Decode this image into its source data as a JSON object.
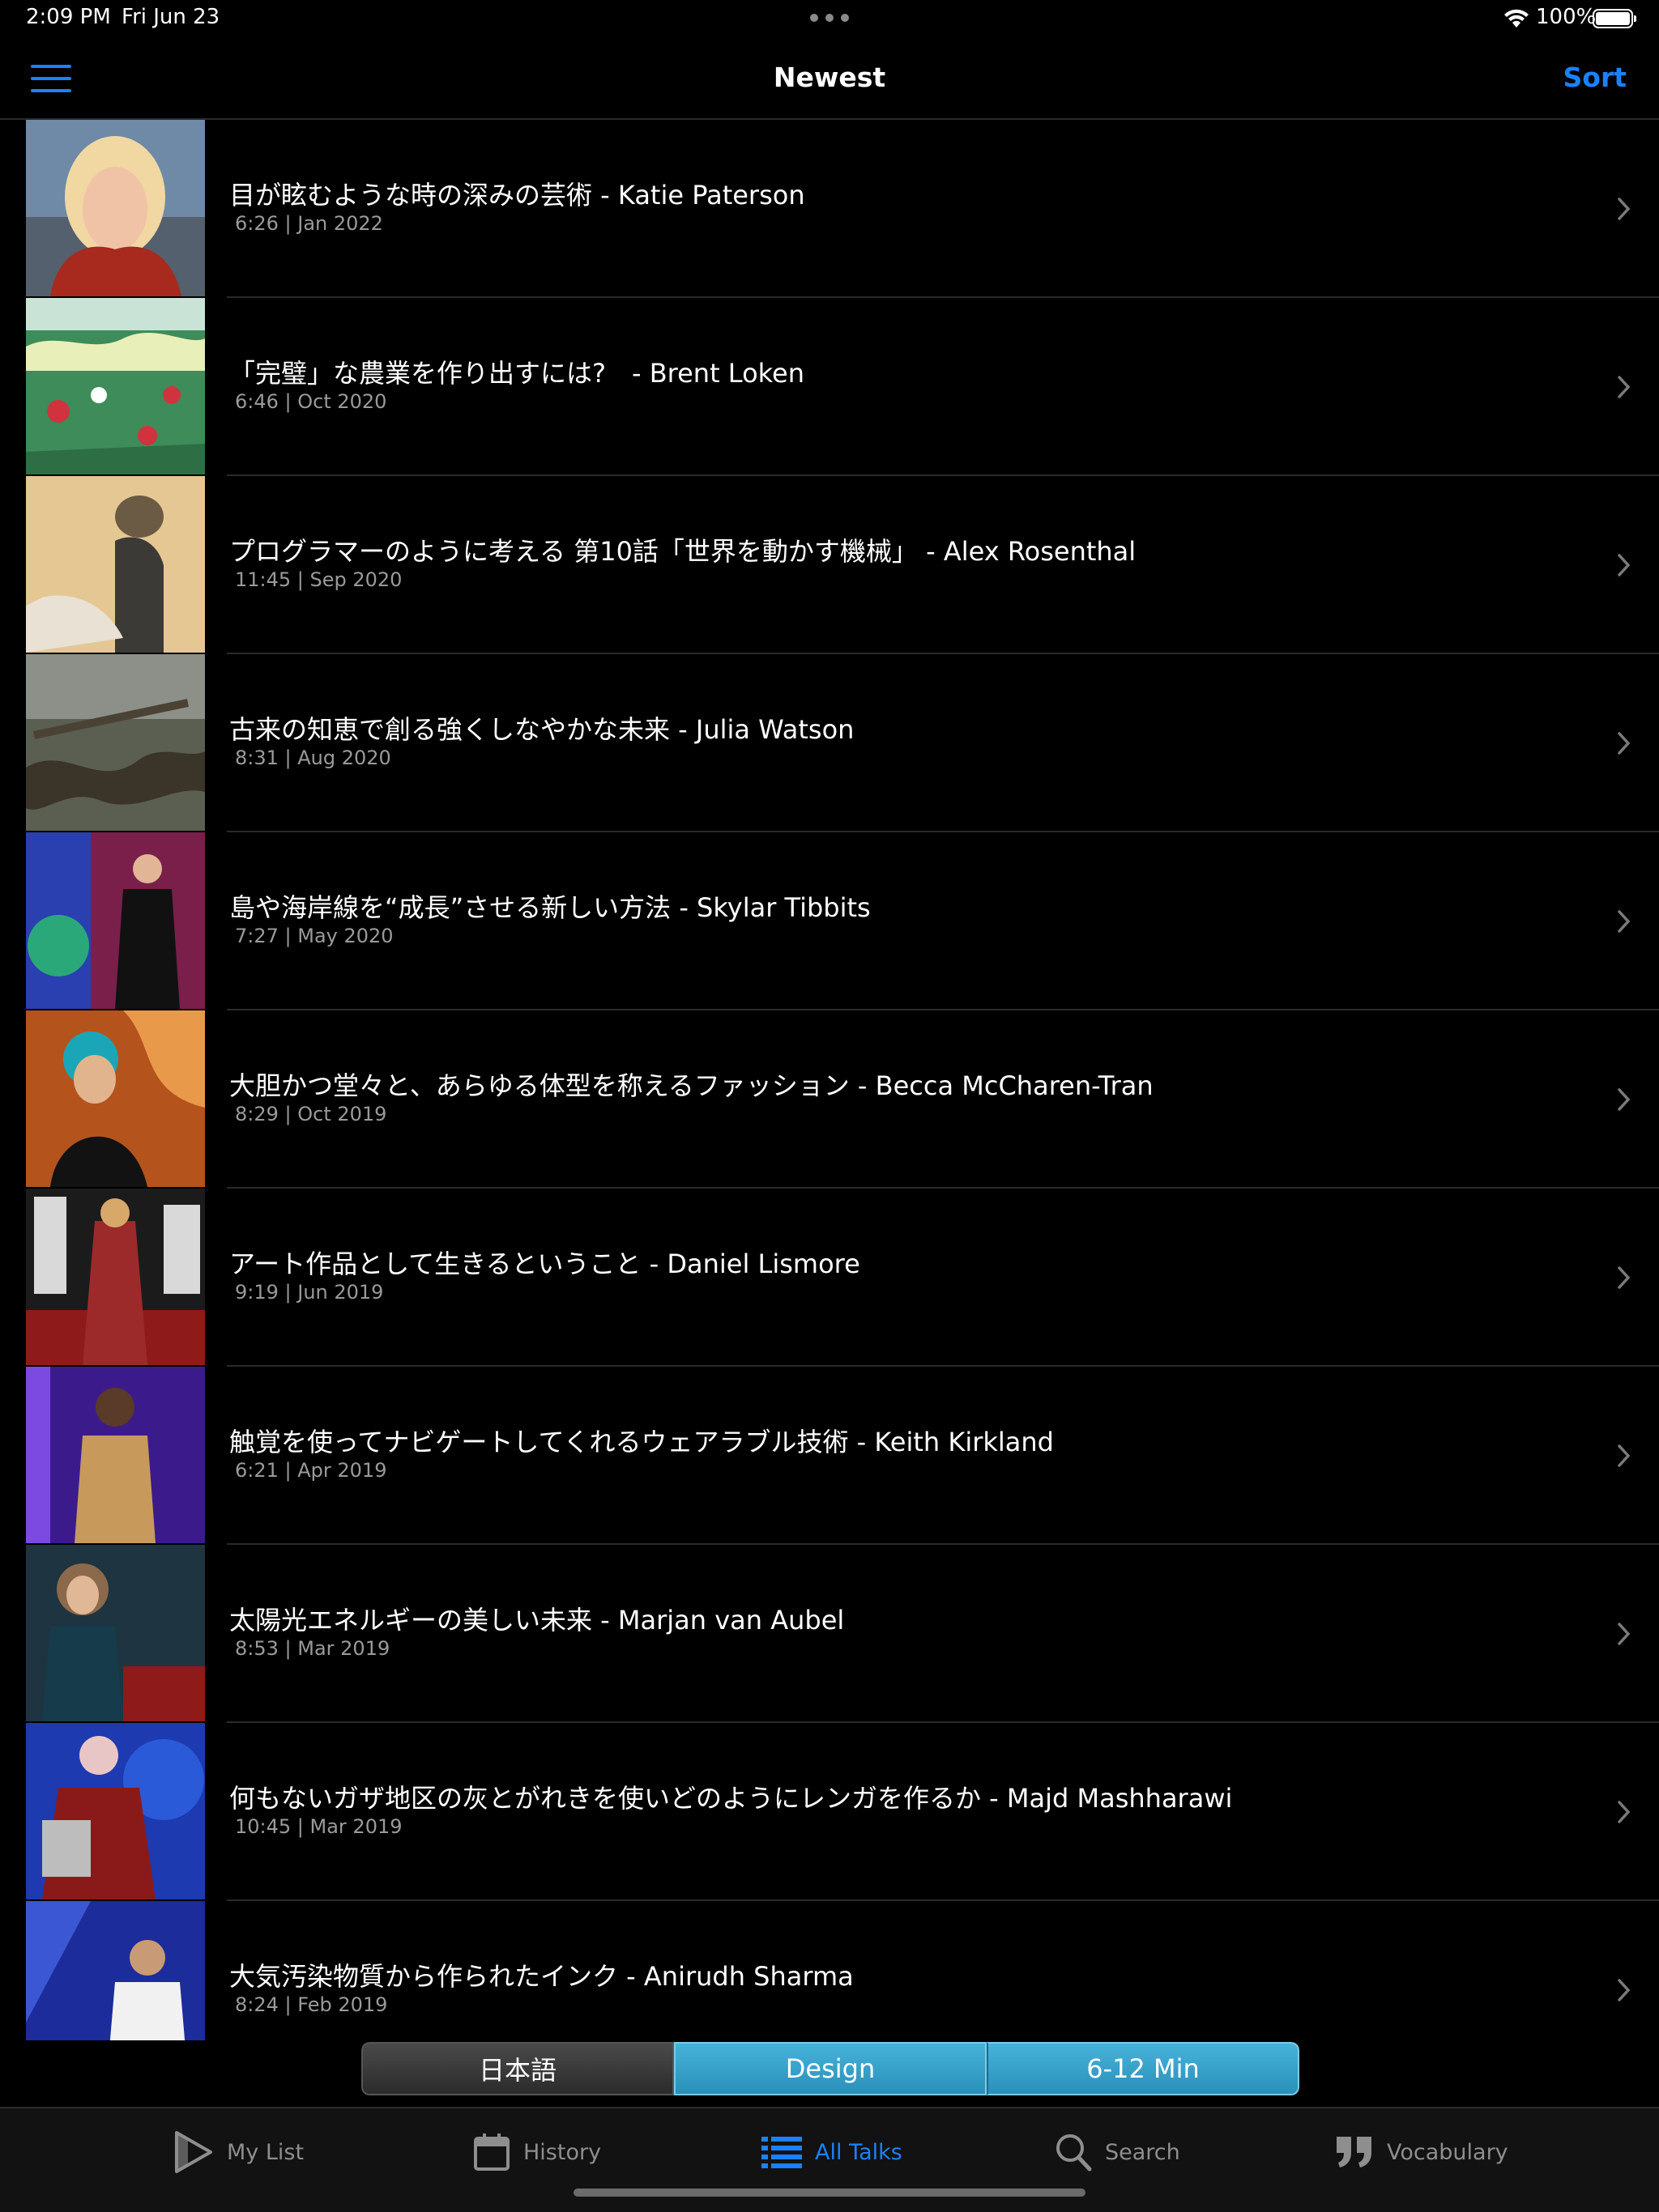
{
  "status_bar": {
    "time": "2:09 PM",
    "date": "Fri Jun 23",
    "battery": "100%",
    "icons": [
      "wifi-icon",
      "battery-icon",
      "multitask-dots-icon"
    ]
  },
  "nav": {
    "title": "Newest",
    "sort_label": "Sort",
    "menu_icon": "hamburger-menu-icon"
  },
  "colors": {
    "accent": "#1a82ff",
    "background": "#000000",
    "secondary_text": "#9a9a9a",
    "filter_active": "#3aa6cf"
  },
  "talks": [
    {
      "title": "目が眩むような時の深みの芸術 - Katie Paterson",
      "meta": "6:26 | Jan 2022"
    },
    {
      "title": "「完璧」な農業を作り出すには?　- Brent Loken",
      "meta": "6:46 | Oct 2020"
    },
    {
      "title": "プログラマーのように考える 第10話「世界を動かす機械」 - Alex Rosenthal",
      "meta": "11:45 | Sep 2020"
    },
    {
      "title": "古来の知恵で創る強くしなやかな未来 - Julia Watson",
      "meta": "8:31 | Aug 2020"
    },
    {
      "title": "島や海岸線を“成長”させる新しい方法 - Skylar Tibbits",
      "meta": "7:27 | May 2020"
    },
    {
      "title": "大胆かつ堂々と、あらゆる体型を称えるファッション - Becca McCharen-Tran",
      "meta": "8:29 | Oct 2019"
    },
    {
      "title": "アート作品として生きるということ - Daniel Lismore",
      "meta": "9:19 | Jun 2019"
    },
    {
      "title": "触覚を使ってナビゲートしてくれるウェアラブル技術 - Keith Kirkland",
      "meta": "6:21 | Apr 2019"
    },
    {
      "title": "太陽光エネルギーの美しい未来 - Marjan van Aubel",
      "meta": "8:53 | Mar 2019"
    },
    {
      "title": "何もないガザ地区の灰とがれきを使いどのようにレンガを作るか - Majd Mashharawi",
      "meta": "10:45 | Mar 2019"
    },
    {
      "title": "大気汚染物質から作られたインク - Anirudh Sharma",
      "meta": "8:24 | Feb 2019"
    }
  ],
  "filters": {
    "language": "日本語",
    "topic": "Design",
    "duration": "6-12 Min"
  },
  "tabs": [
    {
      "label": "My List",
      "icon": "play-triangle-icon",
      "active": false
    },
    {
      "label": "History",
      "icon": "calendar-icon",
      "active": false
    },
    {
      "label": "All Talks",
      "icon": "list-icon",
      "active": true
    },
    {
      "label": "Search",
      "icon": "search-icon",
      "active": false
    },
    {
      "label": "Vocabulary",
      "icon": "quote-icon",
      "active": false
    }
  ]
}
